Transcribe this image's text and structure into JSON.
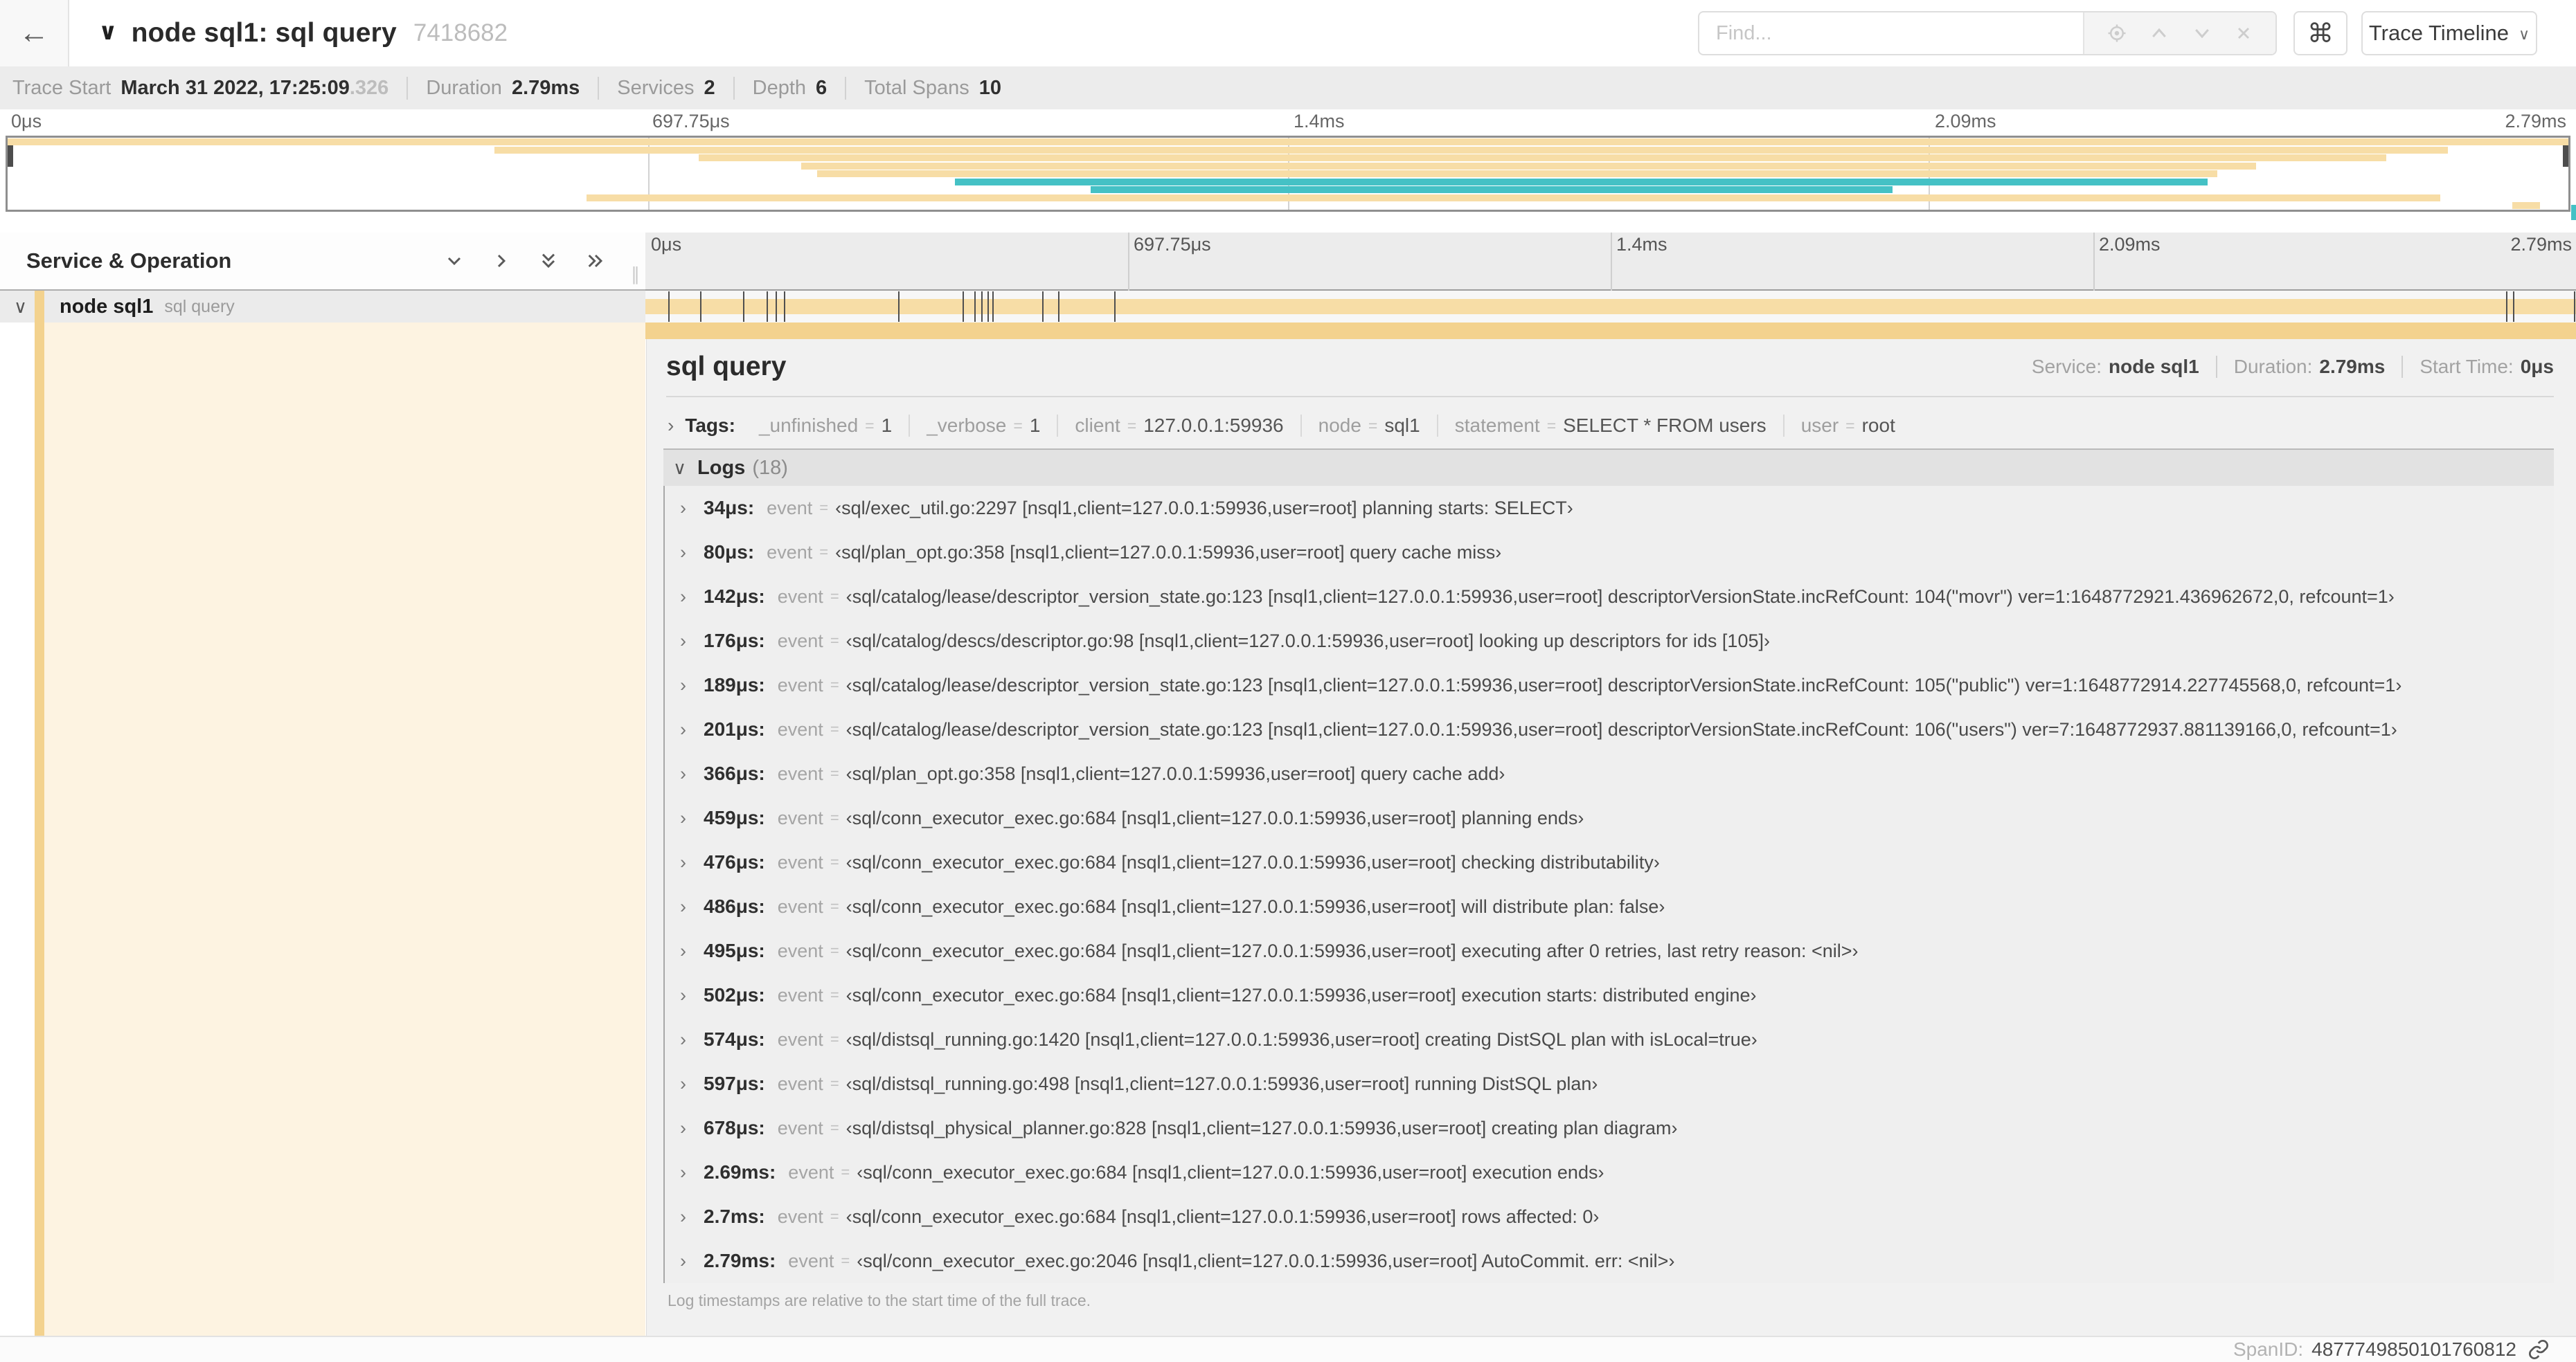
{
  "colors": {
    "tan": "#f7dda6",
    "tan_strong": "#f3d28e",
    "teal": "#45c1c5",
    "cream": "#fdf3e1"
  },
  "header": {
    "back_icon": "←",
    "title": "node sql1: sql query",
    "trace_id": "7418682",
    "find_placeholder": "Find...",
    "shortcut_icon": "⌘",
    "view_selector_label": "Trace Timeline"
  },
  "summary": [
    {
      "label": "Trace Start",
      "value": "March 31 2022, 17:25:09",
      "muted": ".326"
    },
    {
      "label": "Duration",
      "value": "2.79ms"
    },
    {
      "label": "Services",
      "value": "2"
    },
    {
      "label": "Depth",
      "value": "6"
    },
    {
      "label": "Total Spans",
      "value": "10"
    }
  ],
  "ruler": {
    "labels": [
      "0μs",
      "697.75μs",
      "1.4ms",
      "2.09ms",
      "2.79ms"
    ],
    "positions_pct": [
      0,
      25,
      50,
      75,
      100
    ]
  },
  "minimap": {
    "rows": [
      {
        "start": 0,
        "end": 100,
        "color": "tan"
      },
      {
        "start": 19,
        "end": 95.3,
        "color": "tan"
      },
      {
        "start": 27,
        "end": 92.9,
        "color": "tan"
      },
      {
        "start": 31,
        "end": 87.8,
        "color": "tan"
      },
      {
        "start": 31.6,
        "end": 86.3,
        "color": "tan"
      },
      {
        "start": 37,
        "end": 85.9,
        "color": "teal"
      },
      {
        "start": 42.3,
        "end": 73.6,
        "color": "teal"
      },
      {
        "start": 22.6,
        "end": 95,
        "color": "tan"
      },
      {
        "start": 97.8,
        "end": 98.9,
        "color": "tan"
      }
    ]
  },
  "timeline": {
    "duration_us": 2790,
    "log_marks_us": [
      34,
      80,
      142,
      176,
      189,
      201,
      366,
      459,
      476,
      486,
      495,
      502,
      574,
      597,
      678,
      2690,
      2700,
      2790
    ]
  },
  "left_panel": {
    "title": "Service & Operation",
    "row": {
      "service": "node sql1",
      "operation": "sql query"
    }
  },
  "detail": {
    "title": "sql query",
    "meta": [
      {
        "label": "Service:",
        "value": "node sql1"
      },
      {
        "label": "Duration:",
        "value": "2.79ms"
      },
      {
        "label": "Start Time:",
        "value": "0μs"
      }
    ],
    "tags_label": "Tags:",
    "tags": [
      {
        "key": "_unfinished",
        "value": "1"
      },
      {
        "key": "_verbose",
        "value": "1"
      },
      {
        "key": "client",
        "value": "127.0.0.1:59936"
      },
      {
        "key": "node",
        "value": "sql1"
      },
      {
        "key": "statement",
        "value": "SELECT * FROM users"
      },
      {
        "key": "user",
        "value": "root"
      }
    ],
    "logs_label": "Logs",
    "logs_count": "(18)",
    "logs": [
      {
        "time": "34μs:",
        "key": "event",
        "value": "‹sql/exec_util.go:2297 [nsql1,client=127.0.0.1:59936,user=root] planning starts: SELECT›"
      },
      {
        "time": "80μs:",
        "key": "event",
        "value": "‹sql/plan_opt.go:358 [nsql1,client=127.0.0.1:59936,user=root] query cache miss›"
      },
      {
        "time": "142μs:",
        "key": "event",
        "value": "‹sql/catalog/lease/descriptor_version_state.go:123 [nsql1,client=127.0.0.1:59936,user=root] descriptorVersionState.incRefCount: 104(\"movr\") ver=1:1648772921.436962672,0, refcount=1›"
      },
      {
        "time": "176μs:",
        "key": "event",
        "value": "‹sql/catalog/descs/descriptor.go:98 [nsql1,client=127.0.0.1:59936,user=root] looking up descriptors for ids [105]›"
      },
      {
        "time": "189μs:",
        "key": "event",
        "value": "‹sql/catalog/lease/descriptor_version_state.go:123 [nsql1,client=127.0.0.1:59936,user=root] descriptorVersionState.incRefCount: 105(\"public\") ver=1:1648772914.227745568,0, refcount=1›"
      },
      {
        "time": "201μs:",
        "key": "event",
        "value": "‹sql/catalog/lease/descriptor_version_state.go:123 [nsql1,client=127.0.0.1:59936,user=root] descriptorVersionState.incRefCount: 106(\"users\") ver=7:1648772937.881139166,0, refcount=1›"
      },
      {
        "time": "366μs:",
        "key": "event",
        "value": "‹sql/plan_opt.go:358 [nsql1,client=127.0.0.1:59936,user=root] query cache add›"
      },
      {
        "time": "459μs:",
        "key": "event",
        "value": "‹sql/conn_executor_exec.go:684 [nsql1,client=127.0.0.1:59936,user=root] planning ends›"
      },
      {
        "time": "476μs:",
        "key": "event",
        "value": "‹sql/conn_executor_exec.go:684 [nsql1,client=127.0.0.1:59936,user=root] checking distributability›"
      },
      {
        "time": "486μs:",
        "key": "event",
        "value": "‹sql/conn_executor_exec.go:684 [nsql1,client=127.0.0.1:59936,user=root] will distribute plan: false›"
      },
      {
        "time": "495μs:",
        "key": "event",
        "value": "‹sql/conn_executor_exec.go:684 [nsql1,client=127.0.0.1:59936,user=root] executing after 0 retries, last retry reason: <nil>›"
      },
      {
        "time": "502μs:",
        "key": "event",
        "value": "‹sql/conn_executor_exec.go:684 [nsql1,client=127.0.0.1:59936,user=root] execution starts: distributed engine›"
      },
      {
        "time": "574μs:",
        "key": "event",
        "value": "‹sql/distsql_running.go:1420 [nsql1,client=127.0.0.1:59936,user=root] creating DistSQL plan with isLocal=true›"
      },
      {
        "time": "597μs:",
        "key": "event",
        "value": "‹sql/distsql_running.go:498 [nsql1,client=127.0.0.1:59936,user=root] running DistSQL plan›"
      },
      {
        "time": "678μs:",
        "key": "event",
        "value": "‹sql/distsql_physical_planner.go:828 [nsql1,client=127.0.0.1:59936,user=root] creating plan diagram›"
      },
      {
        "time": "2.69ms:",
        "key": "event",
        "value": "‹sql/conn_executor_exec.go:684 [nsql1,client=127.0.0.1:59936,user=root] execution ends›"
      },
      {
        "time": "2.7ms:",
        "key": "event",
        "value": "‹sql/conn_executor_exec.go:684 [nsql1,client=127.0.0.1:59936,user=root] rows affected: 0›"
      },
      {
        "time": "2.79ms:",
        "key": "event",
        "value": "‹sql/conn_executor_exec.go:2046 [nsql1,client=127.0.0.1:59936,user=root] AutoCommit. err: <nil>›"
      }
    ],
    "footnote": "Log timestamps are relative to the start time of the full trace.",
    "span_id_label": "SpanID:",
    "span_id": "4877749850101760812"
  }
}
